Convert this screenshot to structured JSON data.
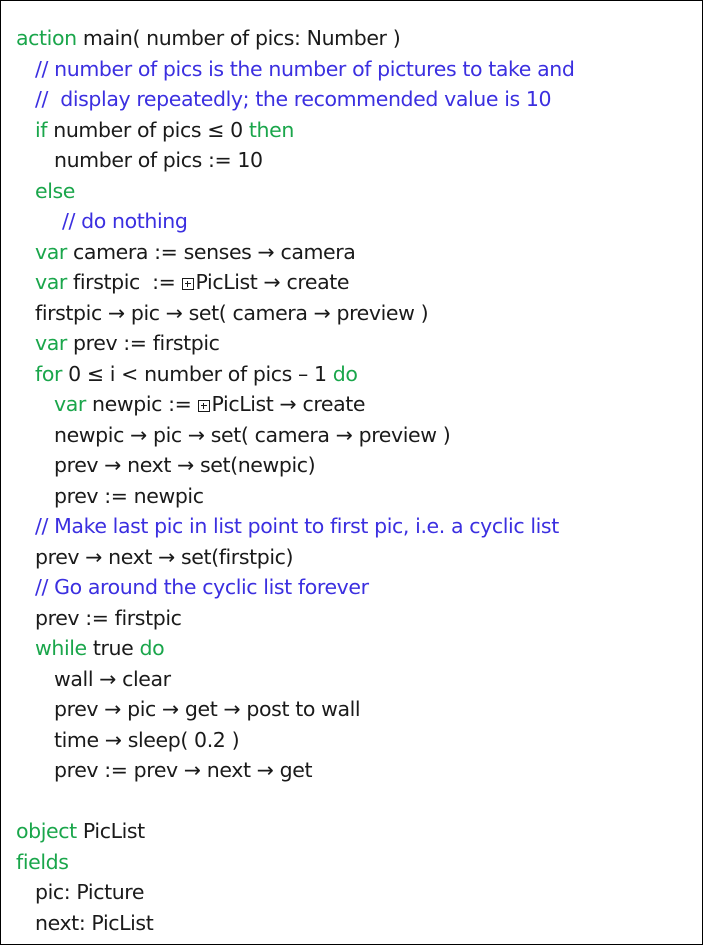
{
  "lines": [
    {
      "indent": 0,
      "tokens": [
        {
          "t": "kw",
          "v": "action"
        },
        {
          "t": "tx",
          "v": " main( number of pics: Number )"
        }
      ]
    },
    {
      "indent": 1,
      "tokens": [
        {
          "t": "cm",
          "v": "// number of pics is the number of pictures to take and"
        }
      ]
    },
    {
      "indent": 1,
      "tokens": [
        {
          "t": "cm",
          "v": "//  display repeatedly; the recommended value is 10"
        }
      ]
    },
    {
      "indent": 1,
      "tokens": [
        {
          "t": "kw",
          "v": "if"
        },
        {
          "t": "tx",
          "v": " number of pics ≤ 0 "
        },
        {
          "t": "kw",
          "v": "then"
        }
      ]
    },
    {
      "indent": 2,
      "tokens": [
        {
          "t": "tx",
          "v": "number of pics := 10"
        }
      ]
    },
    {
      "indent": 1,
      "tokens": [
        {
          "t": "kw",
          "v": "else"
        }
      ]
    },
    {
      "indent": 3,
      "tokens": [
        {
          "t": "cm",
          "v": "// do nothing"
        }
      ]
    },
    {
      "indent": 1,
      "tokens": [
        {
          "t": "kw",
          "v": "var"
        },
        {
          "t": "tx",
          "v": " camera := senses → camera"
        }
      ]
    },
    {
      "indent": 1,
      "tokens": [
        {
          "t": "kw",
          "v": "var"
        },
        {
          "t": "tx",
          "v": " firstpic  := "
        },
        {
          "t": "lib",
          "v": "library-icon"
        },
        {
          "t": "tx",
          "v": "PicList → create"
        }
      ]
    },
    {
      "indent": 1,
      "tokens": [
        {
          "t": "tx",
          "v": "firstpic → pic → set( camera → preview )"
        }
      ]
    },
    {
      "indent": 1,
      "tokens": [
        {
          "t": "kw",
          "v": "var"
        },
        {
          "t": "tx",
          "v": " prev := firstpic"
        }
      ]
    },
    {
      "indent": 1,
      "tokens": [
        {
          "t": "kw",
          "v": "for"
        },
        {
          "t": "tx",
          "v": " 0 ≤ i < number of pics – 1 "
        },
        {
          "t": "kw",
          "v": "do"
        }
      ]
    },
    {
      "indent": 2,
      "tokens": [
        {
          "t": "kw",
          "v": "var"
        },
        {
          "t": "tx",
          "v": " newpic := "
        },
        {
          "t": "lib",
          "v": "library-icon"
        },
        {
          "t": "tx",
          "v": "PicList → create"
        }
      ]
    },
    {
      "indent": 2,
      "tokens": [
        {
          "t": "tx",
          "v": "newpic → pic → set( camera → preview )"
        }
      ]
    },
    {
      "indent": 2,
      "tokens": [
        {
          "t": "tx",
          "v": "prev → next → set(newpic)"
        }
      ]
    },
    {
      "indent": 2,
      "tokens": [
        {
          "t": "tx",
          "v": "prev := newpic"
        }
      ]
    },
    {
      "indent": 1,
      "tokens": [
        {
          "t": "cm",
          "v": "// Make last pic in list point to first pic, i.e. a cyclic list"
        }
      ]
    },
    {
      "indent": 1,
      "tokens": [
        {
          "t": "tx",
          "v": "prev → next → set(firstpic)"
        }
      ]
    },
    {
      "indent": 1,
      "tokens": [
        {
          "t": "cm",
          "v": "// Go around the cyclic list forever"
        }
      ]
    },
    {
      "indent": 1,
      "tokens": [
        {
          "t": "tx",
          "v": "prev := firstpic"
        }
      ]
    },
    {
      "indent": 1,
      "tokens": [
        {
          "t": "kw",
          "v": "while"
        },
        {
          "t": "tx",
          "v": " true "
        },
        {
          "t": "kw",
          "v": "do"
        }
      ]
    },
    {
      "indent": 2,
      "tokens": [
        {
          "t": "tx",
          "v": "wall → clear"
        }
      ]
    },
    {
      "indent": 2,
      "tokens": [
        {
          "t": "tx",
          "v": "prev → pic → get → post to wall"
        }
      ]
    },
    {
      "indent": 2,
      "tokens": [
        {
          "t": "tx",
          "v": "time → sleep( 0.2 )"
        }
      ]
    },
    {
      "indent": 2,
      "tokens": [
        {
          "t": "tx",
          "v": "prev := prev → next → get"
        }
      ]
    },
    {
      "indent": 0,
      "tokens": []
    },
    {
      "indent": 0,
      "tokens": [
        {
          "t": "kw",
          "v": "object"
        },
        {
          "t": "tx",
          "v": " PicList"
        }
      ]
    },
    {
      "indent": 0,
      "tokens": [
        {
          "t": "kw",
          "v": "fields"
        }
      ]
    },
    {
      "indent": 1,
      "tokens": [
        {
          "t": "tx",
          "v": "pic: Picture"
        }
      ]
    },
    {
      "indent": 1,
      "tokens": [
        {
          "t": "tx",
          "v": "next: PicList"
        }
      ]
    }
  ],
  "colors": {
    "keyword": "#1aa64b",
    "comment": "#3b2fe0",
    "text": "#1a1a1a",
    "border": "#000000"
  }
}
